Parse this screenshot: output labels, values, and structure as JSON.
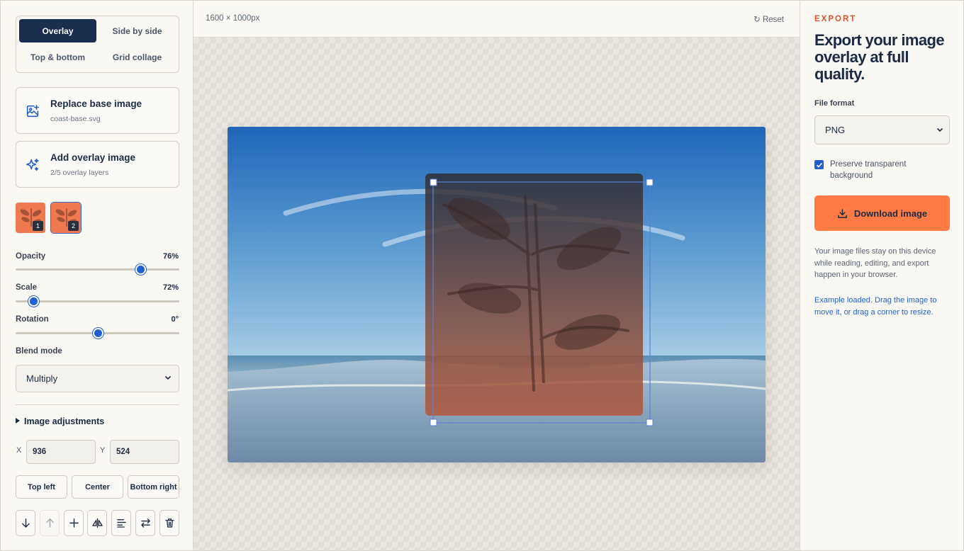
{
  "modes": {
    "overlay": "Overlay",
    "side_by_side": "Side by side",
    "top_bottom": "Top & bottom",
    "grid_collage": "Grid collage",
    "active": "Overlay"
  },
  "replace_card": {
    "title": "Replace base image",
    "subtitle": "coast-base.svg",
    "icon": "image-add-icon"
  },
  "overlay_card": {
    "title": "Add overlay image",
    "subtitle": "2/5 overlay layers",
    "icon": "sparkle-icon"
  },
  "layers": [
    {
      "number": "1"
    },
    {
      "number": "2",
      "selected": true
    }
  ],
  "opacity": {
    "label": "Opacity",
    "value_text": "76%",
    "value": 76
  },
  "scale": {
    "label": "Scale",
    "value_text": "72%",
    "value": 72
  },
  "rotation": {
    "label": "Rotation",
    "value_text": "0°",
    "value": 0
  },
  "blend_mode": {
    "label": "Blend mode",
    "selected": "Multiply"
  },
  "adjustments": {
    "label": "Image adjustments"
  },
  "position": {
    "x_label": "X",
    "x_value": "936",
    "y_label": "Y",
    "y_value": "524"
  },
  "position_buttons": {
    "top_left": "Top left",
    "center": "Center",
    "bottom_right": "Bottom right"
  },
  "toolbar_icons": [
    "move-down-icon",
    "move-up-icon",
    "add-icon",
    "flip-horizontal-icon",
    "align-icon",
    "swap-icon",
    "delete-icon"
  ],
  "canvas": {
    "dimensions": "1600 × 1000px",
    "reset_label": "Reset"
  },
  "export": {
    "eyebrow": "EXPORT",
    "headline": "Export your image overlay at full quality.",
    "file_format_label": "File format",
    "file_format": "PNG",
    "preserve_label": "Preserve transparent background",
    "preserve_checked": true,
    "download_label": "Download image",
    "note": "Your image files stay on this device while reading, editing, and export happen in your browser.",
    "hint": "Example loaded. Drag the image to move it, or drag a corner to resize."
  },
  "colors": {
    "accent": "#ff7a45",
    "primary": "#1a2e4f",
    "link": "#2561c8",
    "eyebrow": "#d9542c"
  }
}
